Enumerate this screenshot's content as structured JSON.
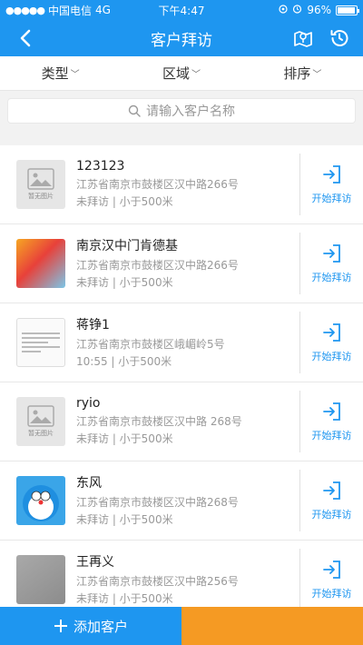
{
  "status": {
    "carrier": "中国电信",
    "network": "4G",
    "time": "下午4:47",
    "battery": "96%",
    "battery_level": 0.96
  },
  "nav": {
    "title": "客户拜访",
    "back_icon": "back-icon",
    "map_icon": "map-icon",
    "history_icon": "history-icon"
  },
  "filters": {
    "type": "类型",
    "area": "区域",
    "sort": "排序"
  },
  "search": {
    "placeholder": "请输入客户名称"
  },
  "customers": [
    {
      "name": "123123",
      "address": "江苏省南京市鼓楼区汉中路266号",
      "status": "未拜访 | 小于500米",
      "thumb": "nopic"
    },
    {
      "name": "南京汉中门肯德基",
      "address": "江苏省南京市鼓楼区汉中路266号",
      "status": "未拜访 | 小于500米",
      "thumb": "kfc"
    },
    {
      "name": "蒋铮1",
      "address": "江苏省南京市鼓楼区峨嵋岭5号",
      "status": "10:55 | 小于500米",
      "thumb": "doc"
    },
    {
      "name": "ryio",
      "address": "江苏省南京市鼓楼区汉中路 268号",
      "status": "未拜访 | 小于500米",
      "thumb": "nopic"
    },
    {
      "name": "东风",
      "address": "江苏省南京市鼓楼区汉中路268号",
      "status": "未拜访 | 小于500米",
      "thumb": "dora"
    },
    {
      "name": "王再义",
      "address": "江苏省南京市鼓楼区汉中路256号",
      "status": "未拜访 | 小于500米",
      "thumb": "gray"
    }
  ],
  "visit_label": "开始拜访",
  "no_picture_label": "暂无图片",
  "bottom": {
    "add_label": "添加客户"
  },
  "colors": {
    "primary": "#1e96f0",
    "accent": "#f59a23"
  }
}
